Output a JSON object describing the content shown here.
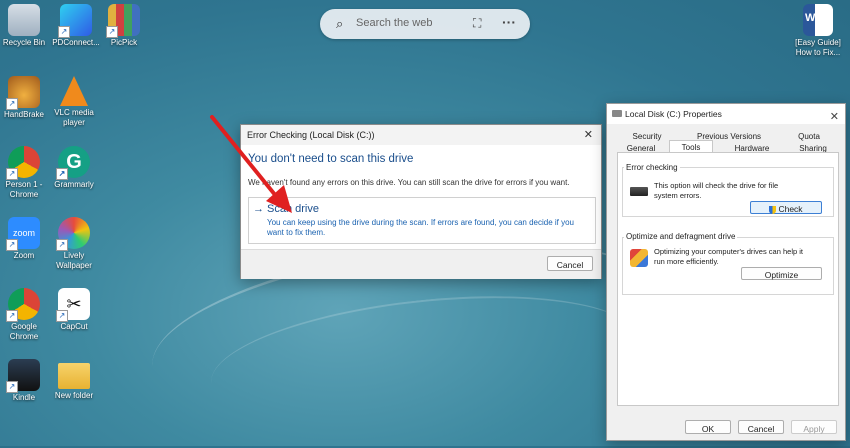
{
  "desktop": {
    "icons": [
      {
        "label": "Recycle Bin",
        "icon": "recycle-bin-icon",
        "shortcut": false,
        "color": "#b8c6d3"
      },
      {
        "label": "PDConnect...",
        "icon": "pdconnect-icon",
        "shortcut": true,
        "color": "#2f7be6"
      },
      {
        "label": "PicPick",
        "icon": "picpick-icon",
        "shortcut": true,
        "color": "#d9a43a"
      },
      {
        "label": "HandBrake",
        "icon": "handbrake-icon",
        "shortcut": true,
        "color": "#c9842c"
      },
      {
        "label": "VLC media player",
        "icon": "vlc-icon",
        "shortcut": true,
        "color": "#f08a1c"
      },
      {
        "label": "Person 1 - Chrome",
        "icon": "chrome-profile-icon",
        "shortcut": true,
        "color": "#db4437"
      },
      {
        "label": "Grammarly",
        "icon": "grammarly-icon",
        "shortcut": true,
        "color": "#15a085"
      },
      {
        "label": "Zoom",
        "icon": "zoom-icon",
        "shortcut": true,
        "color": "#2d8cff"
      },
      {
        "label": "Lively Wallpaper",
        "icon": "lively-wallpaper-icon",
        "shortcut": true,
        "color": "#e74c3c"
      },
      {
        "label": "Google Chrome",
        "icon": "chrome-icon",
        "shortcut": true,
        "color": "#db4437"
      },
      {
        "label": "CapCut",
        "icon": "capcut-icon",
        "shortcut": true,
        "color": "#111111"
      },
      {
        "label": "Kindle",
        "icon": "kindle-icon",
        "shortcut": true,
        "color": "#1b2a3a"
      },
      {
        "label": "New folder",
        "icon": "folder-icon",
        "shortcut": false,
        "color": "#f3c34b"
      },
      {
        "label": "[Easy Guide] How to Fix...",
        "icon": "word-document-icon",
        "shortcut": false,
        "color": "#2b579a"
      }
    ]
  },
  "search": {
    "placeholder": "Search the web",
    "search_icon": "search-icon",
    "visual_search_icon": "visual-search-icon",
    "more_icon": "more-options-icon"
  },
  "error_dialog": {
    "title": "Error Checking (Local Disk (C:))",
    "heading": "You don't need to scan this drive",
    "description": "We haven't found any errors on this drive. You can still scan the drive for errors if you want.",
    "scan_title": "Scan drive",
    "scan_arrow": "→",
    "scan_subtitle": "You can keep using the drive during the scan. If errors are found, you can decide if you want to fix them.",
    "cancel_label": "Cancel",
    "close_glyph": "✕"
  },
  "properties_dialog": {
    "title": "Local Disk (C:) Properties",
    "close_glyph": "✕",
    "tabs_row1": [
      "Security",
      "Previous Versions",
      "Quota"
    ],
    "tabs_row2": [
      "General",
      "Tools",
      "Hardware",
      "Sharing"
    ],
    "active_tab": "Tools",
    "error_checking": {
      "group_label": "Error checking",
      "text": "This option will check the drive for file system errors.",
      "button": "Check"
    },
    "optimize": {
      "group_label": "Optimize and defragment drive",
      "text": "Optimizing your computer's drives can help it run more efficiently.",
      "button": "Optimize"
    },
    "ok_label": "OK",
    "cancel_label": "Cancel",
    "apply_label": "Apply"
  },
  "colors": {
    "accent": "#1a4e8c",
    "link": "#1a62b0",
    "annotation_arrow": "#e02020"
  }
}
